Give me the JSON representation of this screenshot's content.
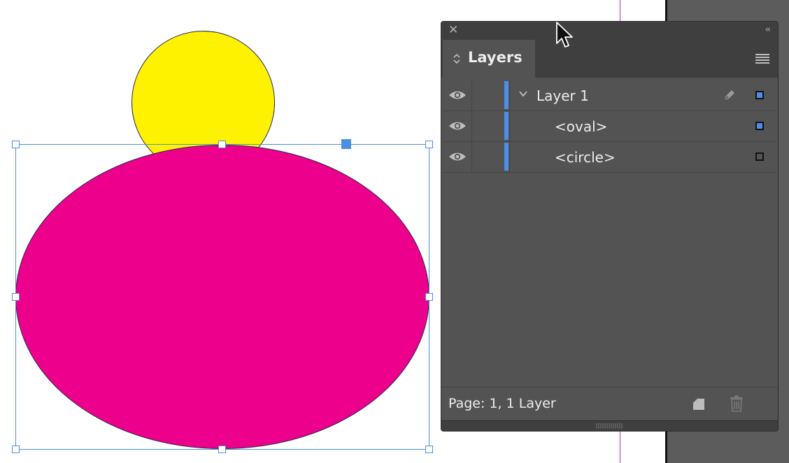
{
  "canvas": {
    "circle_fill": "#fff200",
    "oval_fill": "#ec008c",
    "selection_color": "#4a90e2",
    "guide_color": "#c02cc0"
  },
  "layers_panel": {
    "close_glyph": "✕",
    "collapse_glyph": "‹‹",
    "tab_label": "Layers",
    "rows": [
      {
        "name": "Layer 1",
        "level": 0,
        "expanded": true,
        "visible": true,
        "locked_pen": true,
        "selection_square": "#4d8fe8",
        "layer_color": "#4d8fe8"
      },
      {
        "name": "<oval>",
        "level": 1,
        "visible": true,
        "selection_square": "#4d8fe8"
      },
      {
        "name": "<circle>",
        "level": 1,
        "visible": true,
        "selection_square": "#535353"
      }
    ],
    "footer_text": "Page: 1, 1 Layer",
    "icons": [
      "eye-icon",
      "chevron-down-icon",
      "pen-icon",
      "panel-menu-icon",
      "new-layer-icon",
      "trash-icon",
      "updown-arrows-icon",
      "close-icon",
      "collapse-icon"
    ]
  }
}
